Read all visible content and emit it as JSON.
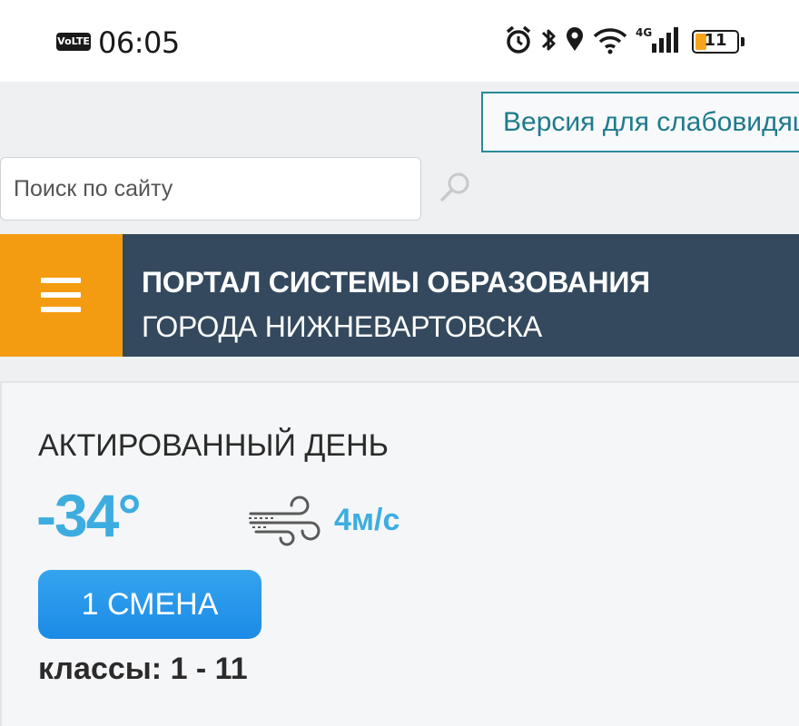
{
  "status_bar": {
    "network_badge": "VoLTE",
    "time": "06:05",
    "network_type": "4G",
    "battery_level": "11",
    "icons": [
      "alarm-icon",
      "bluetooth-icon",
      "location-icon",
      "wifi-icon",
      "signal-icon",
      "battery-icon"
    ]
  },
  "accessibility": {
    "label": "Версия для слабовидящих"
  },
  "search": {
    "placeholder": "Поиск по сайту"
  },
  "header": {
    "title_line1": "ПОРТАЛ СИСТЕМЫ ОБРАЗОВАНИЯ",
    "title_line2": "ГОРОДА НИЖНЕВАРТОВСКА",
    "menu_icon": "hamburger-icon"
  },
  "weather_card": {
    "title": "АКТИРОВАННЫЙ ДЕНЬ",
    "temperature": "-34°",
    "wind_icon": "wind-icon",
    "wind_speed": "4м/с",
    "shift_label": "1 СМЕНА",
    "grades": "классы: 1 - 11"
  },
  "colors": {
    "accent_orange": "#f39c12",
    "header_navy": "#34495e",
    "temperature_blue": "#3dade0",
    "button_blue": "#1b8ae6",
    "a11y_teal": "#1f7a8c"
  }
}
